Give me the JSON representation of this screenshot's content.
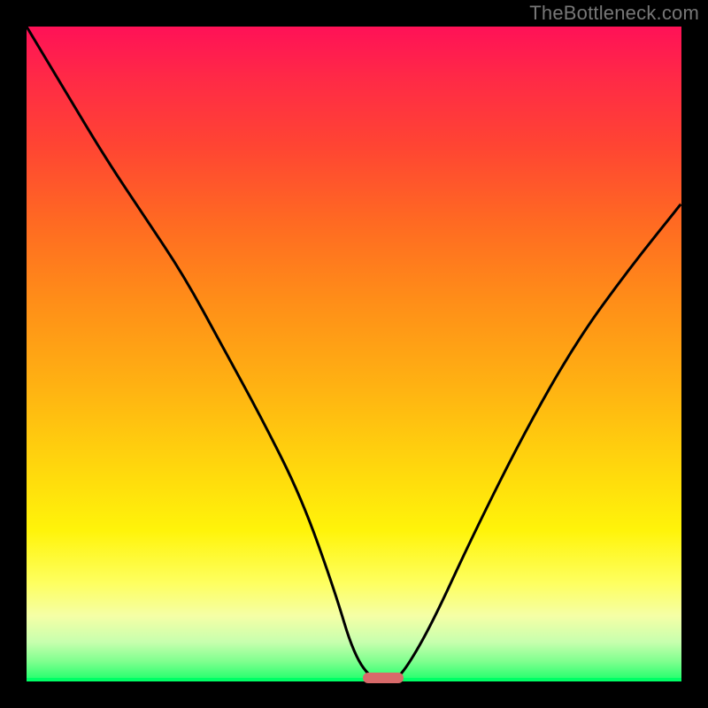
{
  "watermark": "TheBottleneck.com",
  "chart_data": {
    "type": "line",
    "title": "",
    "xlabel": "",
    "ylabel": "",
    "xlim": [
      0,
      100
    ],
    "ylim": [
      0,
      100
    ],
    "grid": false,
    "series": [
      {
        "name": "curve",
        "x": [
          0,
          6,
          12,
          18,
          24,
          30,
          36,
          42,
          47,
          50,
          53,
          56,
          58,
          62,
          68,
          76,
          84,
          92,
          100
        ],
        "y": [
          100,
          90,
          80,
          71,
          62,
          51,
          40,
          28,
          14,
          4,
          0,
          0,
          2,
          9,
          22,
          38,
          52,
          63,
          73
        ]
      }
    ],
    "minimum_marker": {
      "x_pct": 54.5,
      "y_pct": 99.5,
      "color": "#d86a6a"
    },
    "curve_color": "#000000",
    "curve_stroke_width": 3,
    "background_gradient": [
      {
        "stop": 0,
        "color": "#ff1157"
      },
      {
        "stop": 8,
        "color": "#ff2a46"
      },
      {
        "stop": 18,
        "color": "#ff4433"
      },
      {
        "stop": 30,
        "color": "#ff6a22"
      },
      {
        "stop": 42,
        "color": "#ff8e18"
      },
      {
        "stop": 55,
        "color": "#ffb212"
      },
      {
        "stop": 67,
        "color": "#ffd60d"
      },
      {
        "stop": 77,
        "color": "#fff40a"
      },
      {
        "stop": 85,
        "color": "#feff60"
      },
      {
        "stop": 90,
        "color": "#f5ffa6"
      },
      {
        "stop": 94,
        "color": "#c7ffae"
      },
      {
        "stop": 97,
        "color": "#7eff8e"
      },
      {
        "stop": 100,
        "color": "#1aff6a"
      }
    ]
  }
}
